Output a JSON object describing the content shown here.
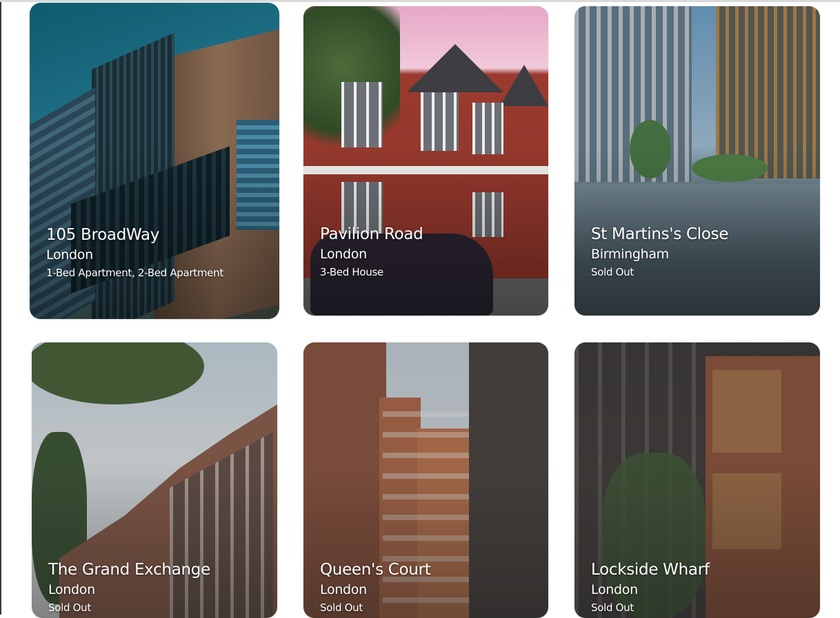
{
  "listings": [
    {
      "title": "105 BroadWay",
      "city": "London",
      "type": "1-Bed Apartment, 2-Bed Apartment"
    },
    {
      "title": "Pavilion Road",
      "city": "London",
      "type": "3-Bed House"
    },
    {
      "title": "St Martins's Close",
      "city": "Birmingham",
      "type": "Sold Out"
    },
    {
      "title": "The Grand Exchange",
      "city": "London",
      "type": "Sold Out"
    },
    {
      "title": "Queen's Court",
      "city": "London",
      "type": "Sold Out"
    },
    {
      "title": "Lockside Wharf",
      "city": "London",
      "type": "Sold Out"
    }
  ]
}
